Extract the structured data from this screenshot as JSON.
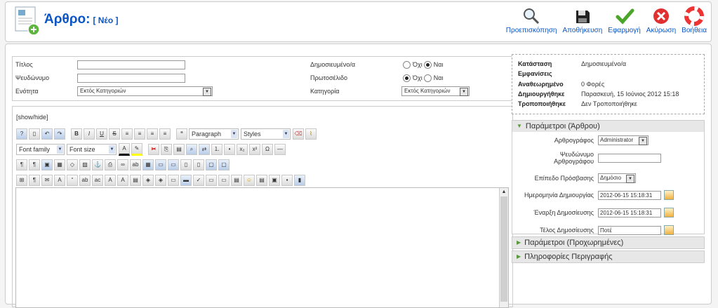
{
  "header": {
    "title": "Άρθρο:",
    "subtitle": "[ Νέο ]"
  },
  "toolbar": {
    "preview": "Προεπισκόπηση",
    "save": "Αποθήκευση",
    "apply": "Εφαρμογή",
    "cancel": "Ακύρωση",
    "help": "Βοήθεια"
  },
  "form": {
    "title_label": "Τίτλος",
    "title_value": "",
    "alias_label": "Ψευδώνυμο",
    "alias_value": "",
    "section_label": "Ενότητα",
    "section_value": "Εκτός Κατηγοριών",
    "published_label": "Δημοσιευμένο/α",
    "published_no": "Όχι",
    "published_yes": "Ναι",
    "frontpage_label": "Πρωτοσέλιδο",
    "frontpage_no": "Όχι",
    "frontpage_yes": "Ναι",
    "category_label": "Κατηγορία",
    "category_value": "Εκτός Κατηγοριών"
  },
  "editor": {
    "showhide": "[show/hide]",
    "format_value": "Paragraph",
    "styles_value": "Styles",
    "font_family": "Font family",
    "font_size": "Font size"
  },
  "status": {
    "state_label": "Κατάσταση",
    "state_value": "Δημοσιευμένο/α",
    "views_label": "Εμφανίσεις",
    "views_value": "",
    "revised_label": "Αναθεωρημένο",
    "revised_value": "0 Φορές",
    "created_label": "Δημιουργήθηκε",
    "created_value": "Παρασκευή, 15 Ιούνιος 2012 15:18",
    "modified_label": "Τροποποιήθηκε",
    "modified_value": "Δεν Τροποποιήθηκε"
  },
  "params": {
    "header": "Παράμετροι (Άρθρου)",
    "author_label": "Αρθρογράφος",
    "author_value": "Administrator",
    "alias_label_1": "Ψευδώνυμο",
    "alias_label_2": "Αρθρογράφου",
    "alias_value": "",
    "access_label": "Επίπεδο Πρόσβασης",
    "access_value": "Δημόσιο",
    "created_label": "Ημερομηνία Δημιουργίας",
    "created_value": "2012-06-15 15:18:31",
    "start_label": "Έναρξη Δημοσίευσης",
    "start_value": "2012-06-15 15:18:31",
    "end_label": "Τέλος Δημοσίευσης",
    "end_value": "Ποτέ"
  },
  "advanced_header": "Παράμετροι (Προχωρημένες)",
  "meta_header": "Πληροφορίες Περιγραφής"
}
